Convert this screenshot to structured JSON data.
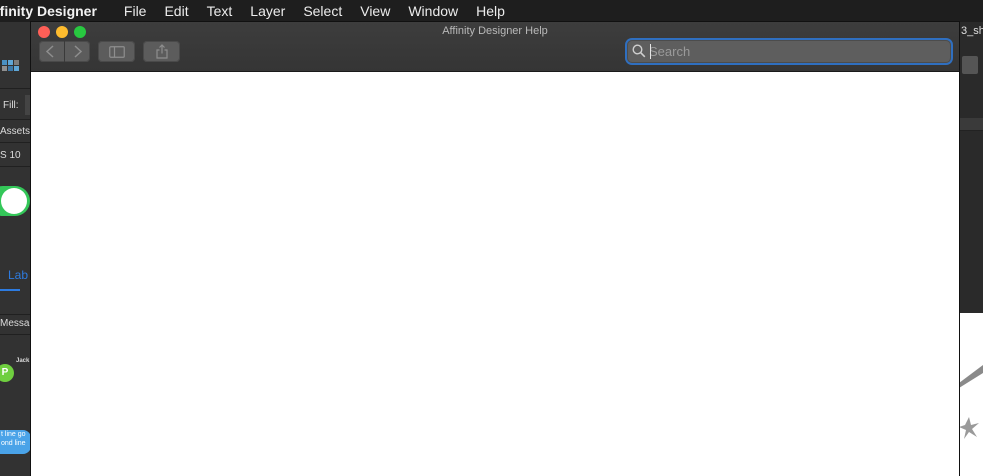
{
  "menubar": {
    "app_name": "ffinity Designer",
    "items": [
      "File",
      "Edit",
      "Text",
      "Layer",
      "Select",
      "View",
      "Window",
      "Help"
    ]
  },
  "background_app": {
    "fill_label": "Fill:",
    "assets_label": "Assets",
    "ios_label": "S 10",
    "tab_label": "Lab",
    "messages_label": "Messa",
    "contact_name": "Jack",
    "avatar_initial": "P",
    "bubble_line1": "t line go",
    "bubble_line2": "ond line",
    "filename": "3_sh"
  },
  "help_window": {
    "title": "Affinity Designer Help",
    "search": {
      "placeholder": "Search",
      "value": ""
    },
    "icons": {
      "back": "chevron-left-icon",
      "forward": "chevron-right-icon",
      "sidebar": "sidebar-icon",
      "share": "share-icon",
      "search": "search-icon"
    }
  },
  "colors": {
    "accent": "#2f6fc0",
    "close": "#ff5f57",
    "minimize": "#febc2e",
    "maximize": "#28c840",
    "toggle_on": "#34c759"
  }
}
